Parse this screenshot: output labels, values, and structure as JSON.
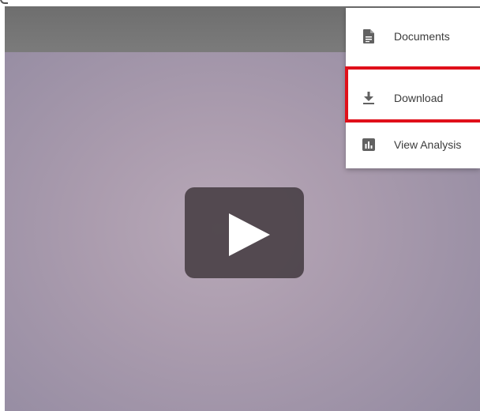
{
  "menu": {
    "items": [
      {
        "label": "Documents",
        "icon": "document-icon"
      },
      {
        "label": "Download",
        "icon": "download-icon"
      },
      {
        "label": "View Analysis",
        "icon": "bar-chart-icon"
      }
    ]
  },
  "colors": {
    "highlight": "#e0101a",
    "menu_icon": "#616161",
    "play_button_bg": "#463c42",
    "video_topbar": "#737373"
  },
  "player": {
    "play_icon": "play-icon"
  }
}
